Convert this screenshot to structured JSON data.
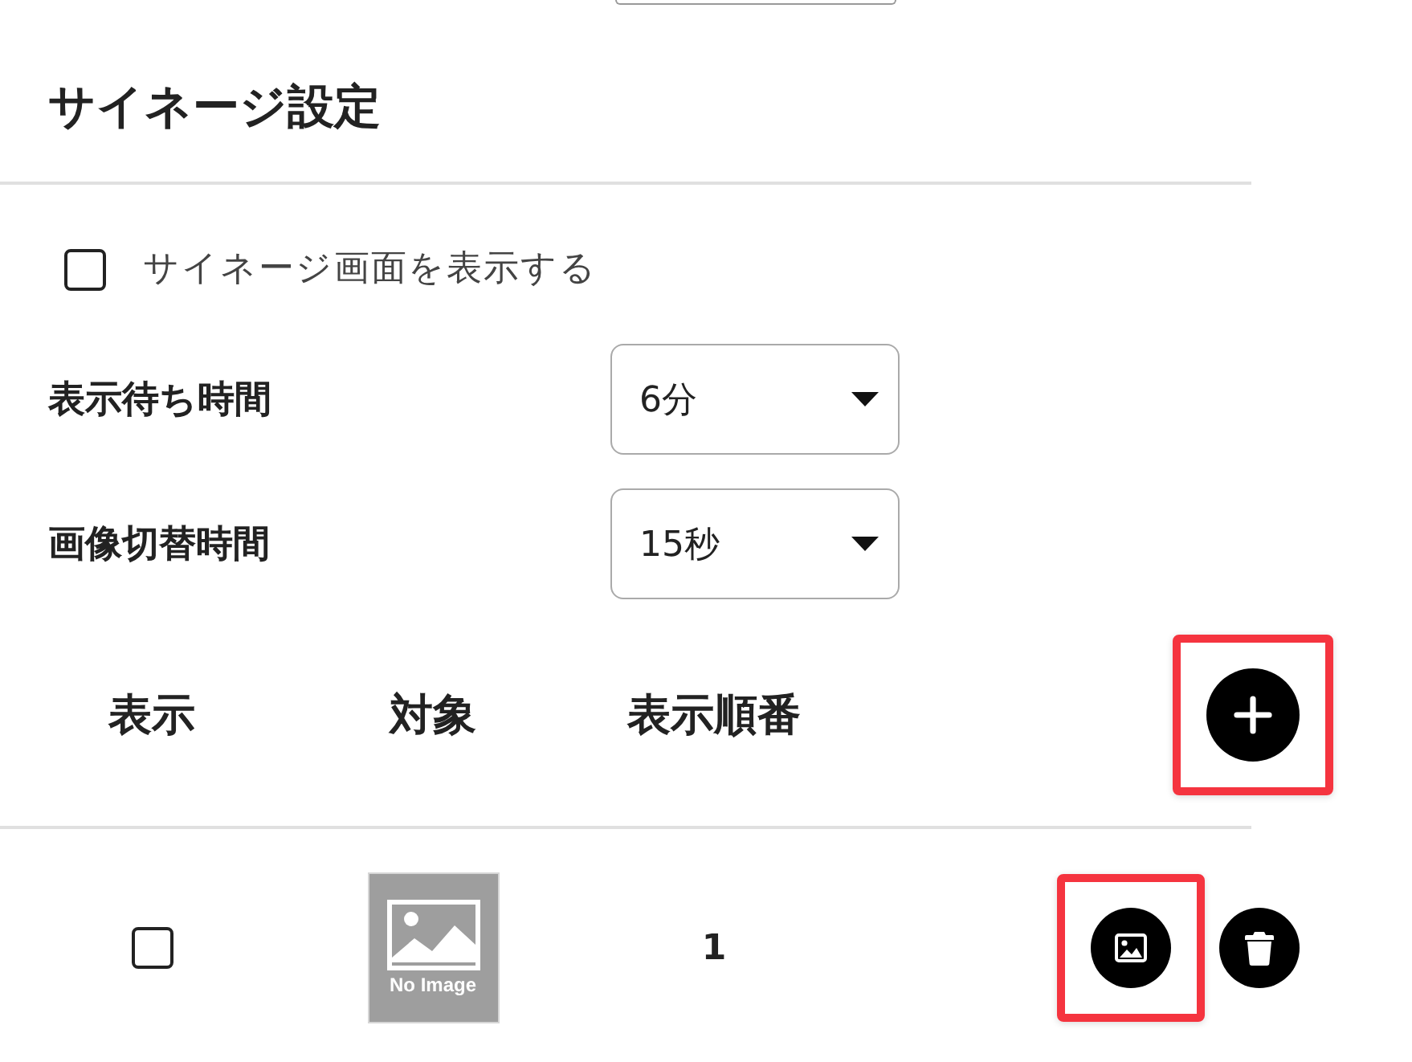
{
  "section": {
    "title": "サイネージ設定"
  },
  "show_signage": {
    "label": "サイネージ画面を表示する",
    "checked": false
  },
  "settings": [
    {
      "label": "表示待ち時間",
      "value": "6分"
    },
    {
      "label": "画像切替時間",
      "value": "15秒"
    }
  ],
  "table": {
    "columns": [
      "表示",
      "対象",
      "表示順番"
    ],
    "add_button": {
      "highlighted": true
    },
    "rows": [
      {
        "checked": false,
        "thumbnail": {
          "text": "No Image"
        },
        "order": "1",
        "image_button": {
          "highlighted": true
        },
        "delete_button": {
          "highlighted": false
        }
      }
    ]
  }
}
